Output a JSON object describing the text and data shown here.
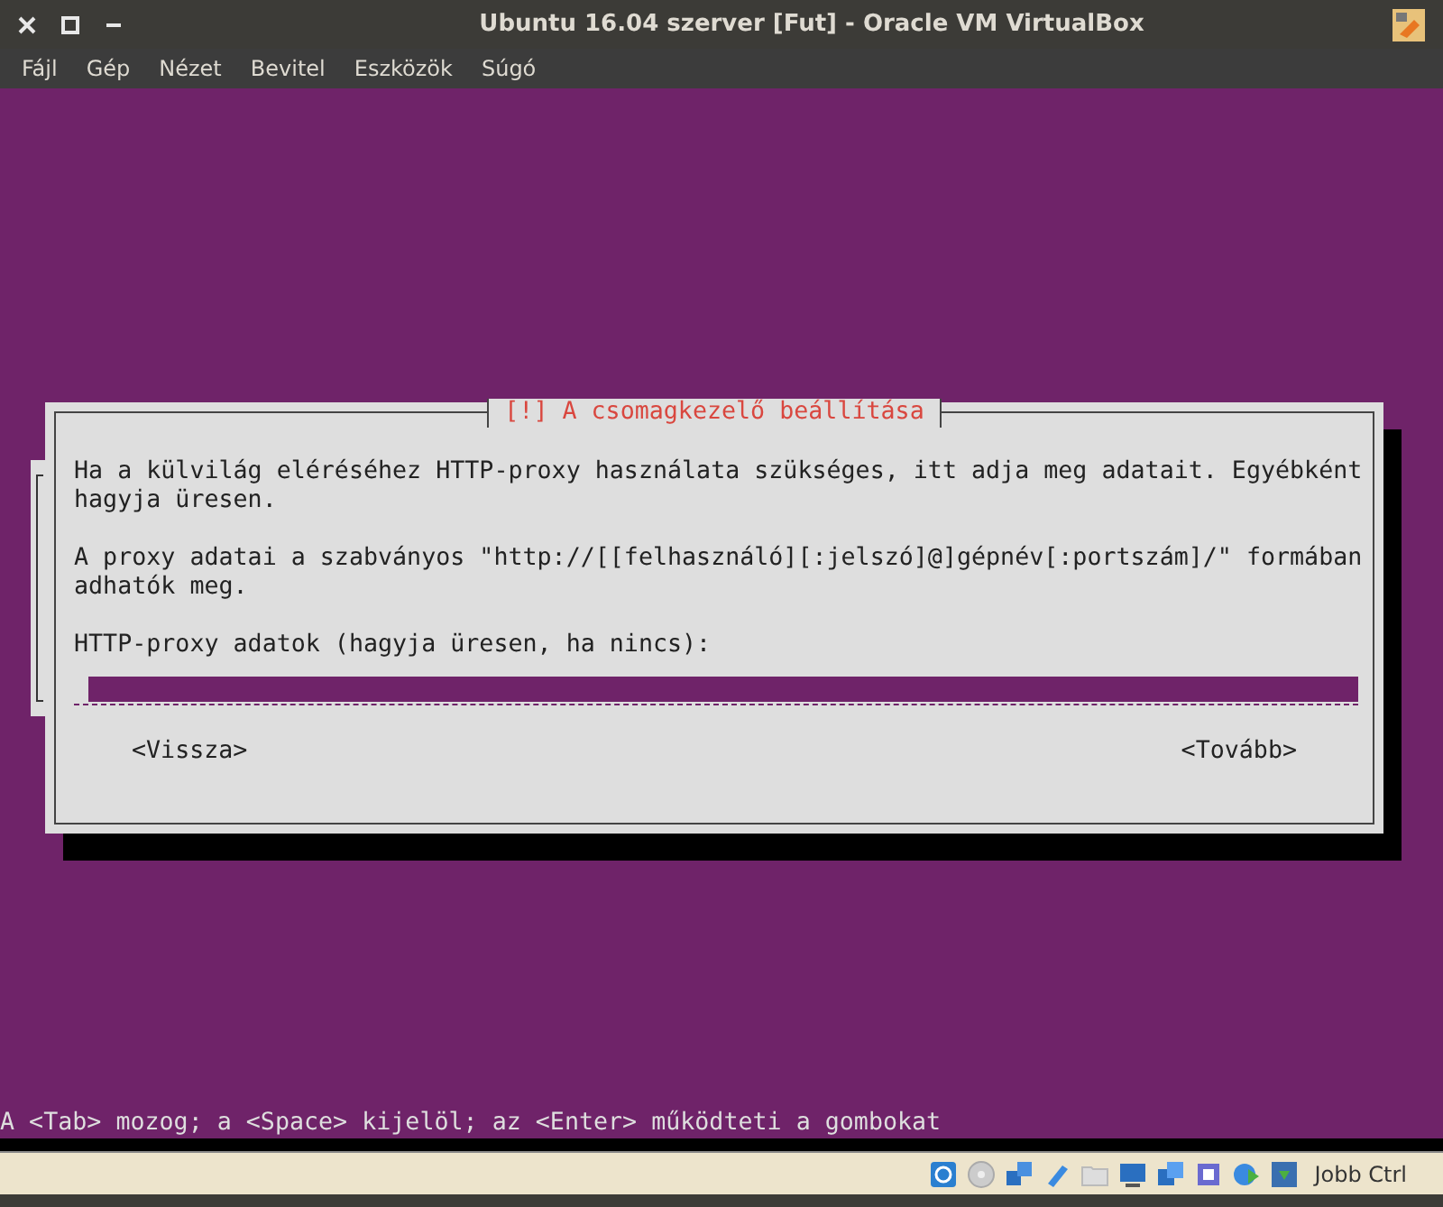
{
  "window": {
    "title": "Ubuntu 16.04 szerver [Fut] - Oracle VM VirtualBox"
  },
  "menu": [
    "Fájl",
    "Gép",
    "Nézet",
    "Bevitel",
    "Eszközök",
    "Súgó"
  ],
  "dialog": {
    "title": "[!] A csomagkezelő beállítása",
    "paragraphs": [
      "Ha a külvilág eléréséhez HTTP-proxy használata szükséges, itt adja meg adatait. Egyébként hagyja üresen.",
      "A proxy adatai a szabványos \"http://[[felhasználó][:jelszó]@]gépnév[:portszám]/\" formában adhatók meg."
    ],
    "field_label": "HTTP-proxy adatok (hagyja üresen, ha nincs):",
    "buttons": [
      "<Vissza>",
      "<Tovább>"
    ]
  },
  "hint": "A <Tab> mozog; a <Space> kijelöl; az <Enter> működteti a gombokat",
  "status_bar": {
    "host_key": "Jobb Ctrl"
  }
}
